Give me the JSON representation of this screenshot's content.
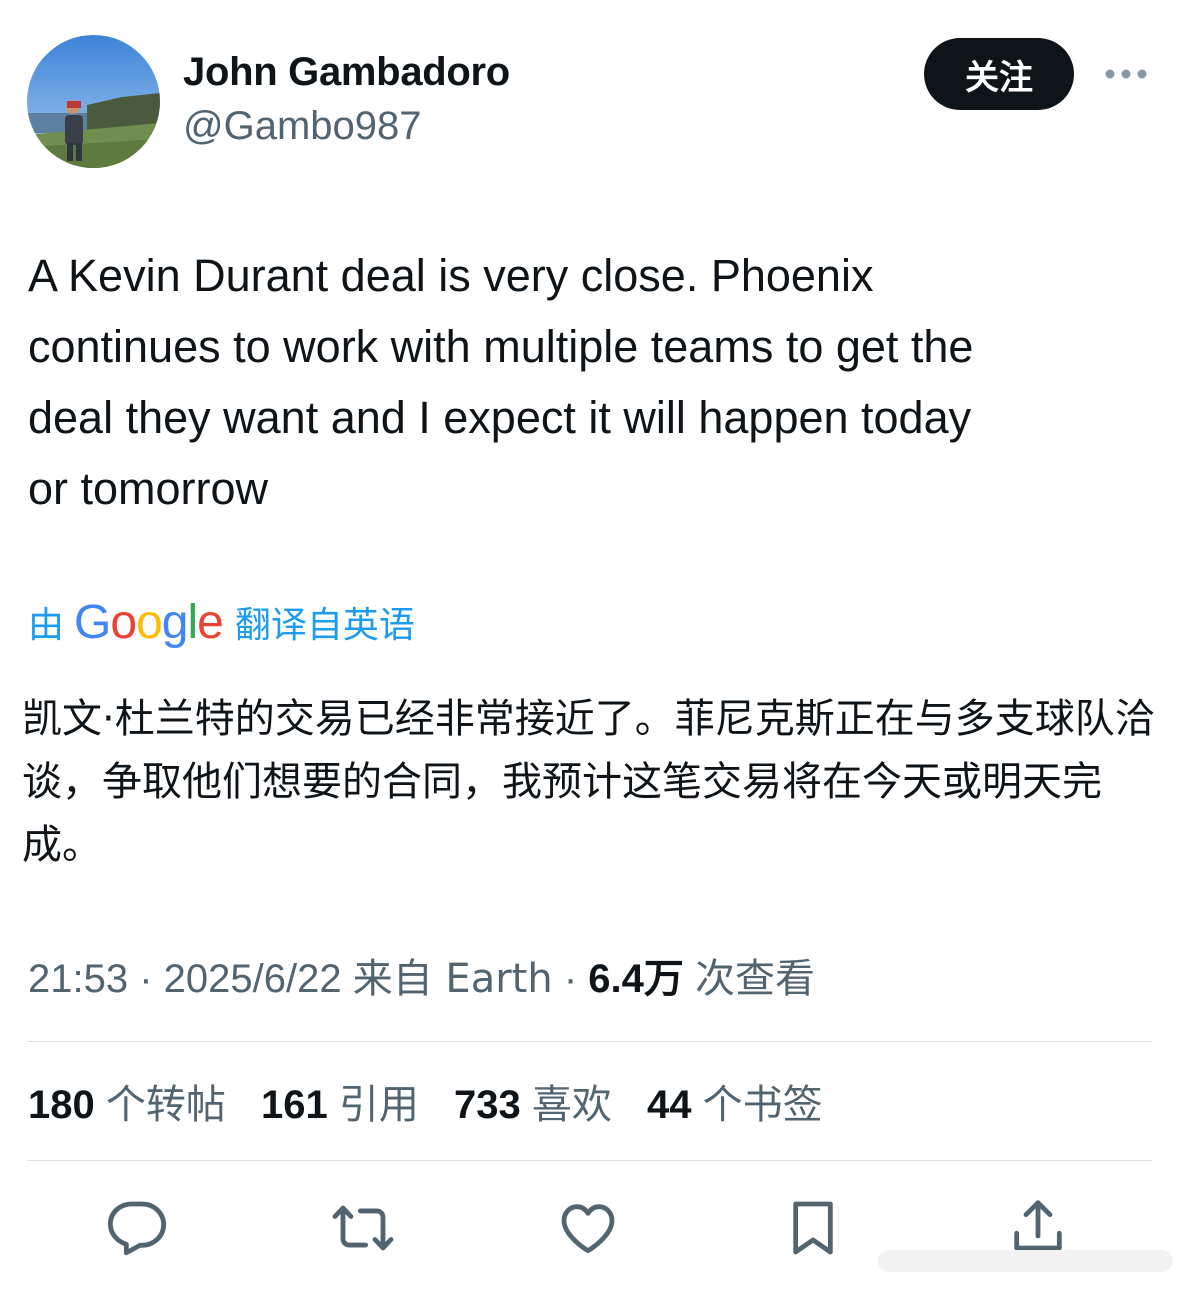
{
  "user": {
    "name": "John Gambadoro",
    "handle": "@Gambo987"
  },
  "header": {
    "follow_label": "关注"
  },
  "tweet": {
    "text": "A Kevin Durant deal is very close. Phoenix\ncontinues to work with multiple teams to get the\ndeal they want and I expect it will happen today\nor tomorrow"
  },
  "translation": {
    "prefix": "由",
    "brand": "Google",
    "suffix": "翻译自英语",
    "text": "凯文·杜兰特的交易已经非常接近了。菲尼克斯正在与多支球队洽谈，争取他们想要的合同，我预计这笔交易将在今天或明天完成。"
  },
  "meta": {
    "time": "21:53 · 2025/6/22",
    "source": "来自 Earth",
    "views_count": "6.4万",
    "views_label": "次查看"
  },
  "stats": {
    "reposts_count": "180",
    "reposts_label": "个转帖",
    "quotes_count": "161",
    "quotes_label": "引用",
    "likes_count": "733",
    "likes_label": "喜欢",
    "bookmarks_count": "44",
    "bookmarks_label": "个书签"
  },
  "colors": {
    "text": "#0f1419",
    "secondary": "#536471",
    "accent": "#1d9bf0",
    "follow_bg": "#0f1419"
  },
  "icons": [
    "reply-icon",
    "repost-icon",
    "like-icon",
    "bookmark-icon",
    "share-icon",
    "more-icon"
  ]
}
